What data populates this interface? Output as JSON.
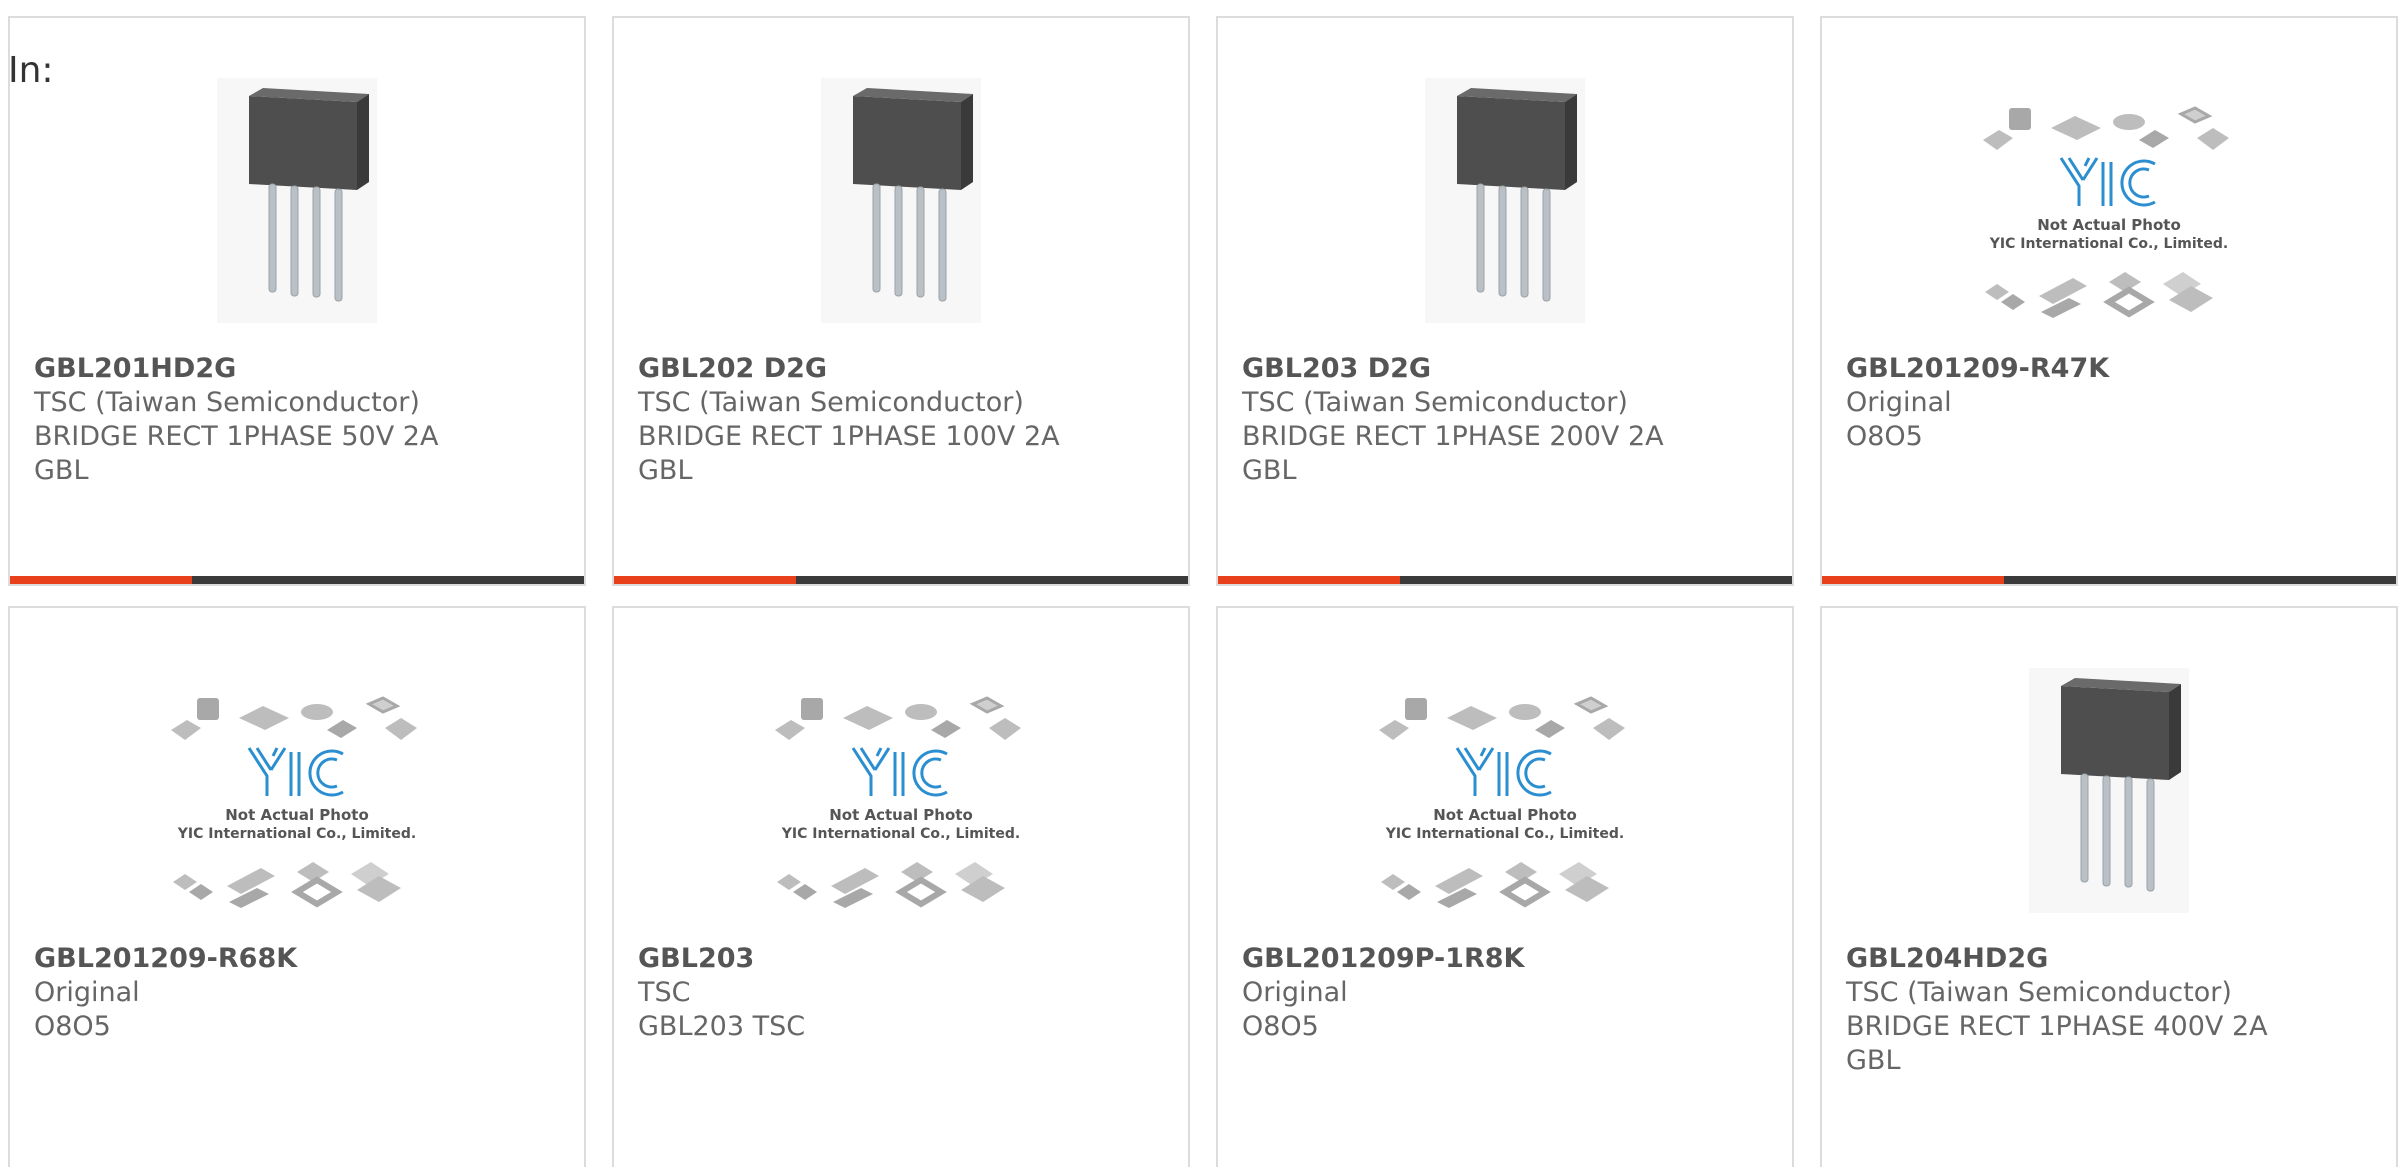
{
  "in_label": "In:",
  "colors": {
    "accent": "#e8401a",
    "bar": "#3a3a3a",
    "border": "#dcdcdc",
    "yic_logo": "#2a8ed0"
  },
  "products": [
    {
      "part_number": "GBL201HD2G",
      "line1": "TSC (Taiwan Semiconductor)",
      "line2": "BRIDGE RECT 1PHASE 50V 2A",
      "line3": "GBL",
      "image": "bridge-rectifier-photo",
      "accent_bar": true
    },
    {
      "part_number": "GBL202 D2G",
      "line1": "TSC (Taiwan Semiconductor)",
      "line2": "BRIDGE RECT 1PHASE 100V 2A",
      "line3": "GBL",
      "image": "bridge-rectifier-photo",
      "accent_bar": true
    },
    {
      "part_number": "GBL203 D2G",
      "line1": "TSC (Taiwan Semiconductor)",
      "line2": "BRIDGE RECT 1PHASE 200V 2A",
      "line3": "GBL",
      "image": "bridge-rectifier-photo",
      "accent_bar": true
    },
    {
      "part_number": "GBL201209-R47K",
      "line1": "Original",
      "line2": "O8O5",
      "line3": "",
      "image": "not-actual-photo-placeholder",
      "placeholder_line1": "Not Actual Photo",
      "placeholder_line2": "YIC International Co., Limited.",
      "logo_text": "YIC",
      "accent_bar": true
    },
    {
      "part_number": "GBL201209-R68K",
      "line1": "Original",
      "line2": "O8O5",
      "line3": "",
      "image": "not-actual-photo-placeholder",
      "placeholder_line1": "Not Actual Photo",
      "placeholder_line2": "YIC International Co., Limited.",
      "logo_text": "YIC",
      "accent_bar": false
    },
    {
      "part_number": "GBL203",
      "line1": "TSC",
      "line2": "GBL203 TSC",
      "line3": "",
      "image": "not-actual-photo-placeholder",
      "placeholder_line1": "Not Actual Photo",
      "placeholder_line2": "YIC International Co., Limited.",
      "logo_text": "YIC",
      "accent_bar": false
    },
    {
      "part_number": "GBL201209P-1R8K",
      "line1": "Original",
      "line2": "O8O5",
      "line3": "",
      "image": "not-actual-photo-placeholder",
      "placeholder_line1": "Not Actual Photo",
      "placeholder_line2": "YIC International Co., Limited.",
      "logo_text": "YIC",
      "accent_bar": false
    },
    {
      "part_number": "GBL204HD2G",
      "line1": "TSC (Taiwan Semiconductor)",
      "line2": "BRIDGE RECT 1PHASE 400V 2A",
      "line3": "GBL",
      "image": "bridge-rectifier-photo",
      "accent_bar": false
    }
  ]
}
